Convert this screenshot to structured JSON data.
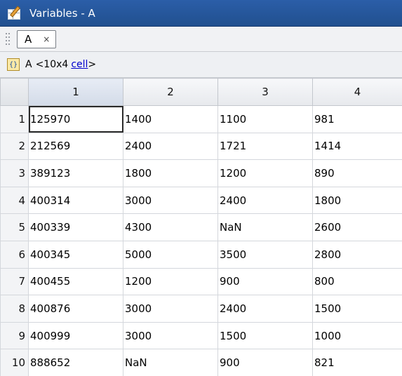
{
  "window": {
    "title": "Variables - A"
  },
  "tabs": [
    {
      "label": "A",
      "close": "×"
    }
  ],
  "variable": {
    "icon": "{}",
    "name": "A",
    "size": "<10x4",
    "class": "cell",
    "suffix": ">"
  },
  "table": {
    "columns": [
      "1",
      "2",
      "3",
      "4"
    ],
    "rows": [
      {
        "index": "1",
        "cells": [
          "125970",
          "1400",
          "1100",
          "981"
        ]
      },
      {
        "index": "2",
        "cells": [
          "212569",
          "2400",
          "1721",
          "1414"
        ]
      },
      {
        "index": "3",
        "cells": [
          "389123",
          "1800",
          "1200",
          "890"
        ]
      },
      {
        "index": "4",
        "cells": [
          "400314",
          "3000",
          "2400",
          "1800"
        ]
      },
      {
        "index": "5",
        "cells": [
          "400339",
          "4300",
          "NaN",
          "2600"
        ]
      },
      {
        "index": "6",
        "cells": [
          "400345",
          "5000",
          "3500",
          "2800"
        ]
      },
      {
        "index": "7",
        "cells": [
          "400455",
          "1200",
          "900",
          "800"
        ]
      },
      {
        "index": "8",
        "cells": [
          "400876",
          "3000",
          "2400",
          "1500"
        ]
      },
      {
        "index": "9",
        "cells": [
          "400999",
          "3000",
          "1500",
          "1000"
        ]
      },
      {
        "index": "10",
        "cells": [
          "888652",
          "NaN",
          "900",
          "821"
        ]
      }
    ]
  },
  "icons": {
    "window": "variable-editor-icon",
    "cell": "cell-array-icon",
    "close": "close-icon",
    "grip": "drag-grip-icon"
  }
}
